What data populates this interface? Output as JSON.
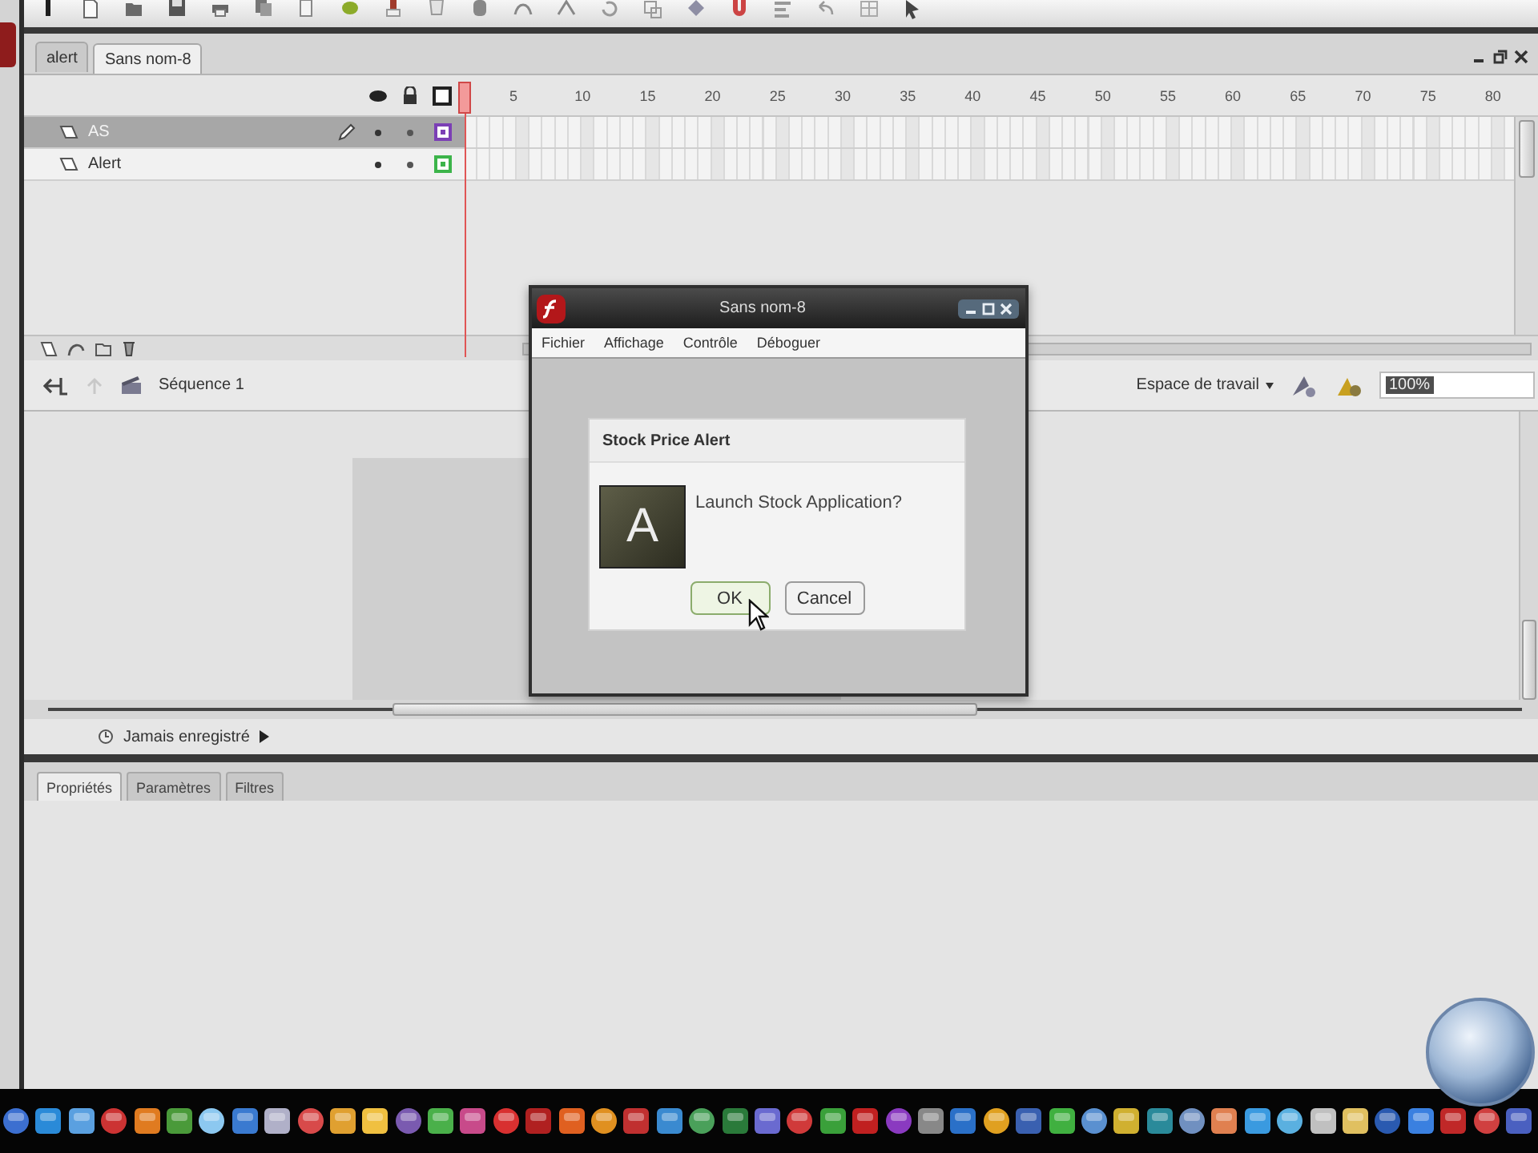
{
  "document_tabs": [
    {
      "label": "alert",
      "selected": false
    },
    {
      "label": "Sans nom-8",
      "selected": true
    }
  ],
  "timeline": {
    "frame_numbers": [
      "5",
      "10",
      "15",
      "20",
      "25",
      "30",
      "35",
      "40",
      "45",
      "50",
      "55",
      "60",
      "65",
      "70",
      "75",
      "80"
    ],
    "layers": [
      {
        "name": "AS",
        "selected": true,
        "color": "#7b3fb5"
      },
      {
        "name": "Alert",
        "selected": false,
        "color": "#3cb44a"
      }
    ]
  },
  "edit_bar": {
    "scene": "Séquence 1",
    "workspace": "Espace de travail",
    "zoom": "100%"
  },
  "status_bar": {
    "text": "Jamais enregistré"
  },
  "panel_tabs": [
    {
      "label": "Propriétés",
      "selected": true
    },
    {
      "label": "Paramètres",
      "selected": false
    },
    {
      "label": "Filtres",
      "selected": false
    }
  ],
  "player_window": {
    "title": "Sans nom-8",
    "menu": [
      "Fichier",
      "Affichage",
      "Contrôle",
      "Déboguer"
    ],
    "alert": {
      "title": "Stock Price Alert",
      "message": "Launch Stock Application?",
      "icon_letter": "A",
      "buttons": [
        {
          "label": "OK",
          "focused": true
        },
        {
          "label": "Cancel",
          "focused": false
        }
      ]
    }
  }
}
